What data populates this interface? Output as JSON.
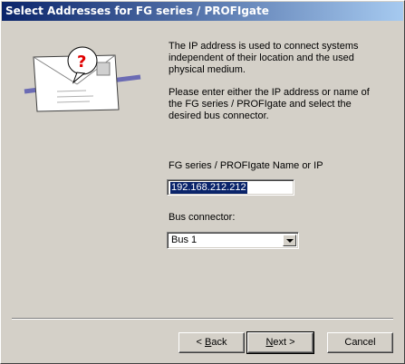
{
  "window": {
    "title": "Select Addresses for FG series / PROFIgate"
  },
  "description": [
    "The IP address is used to connect systems independent of their location and the used physical medium.",
    "Please enter either the IP address or name of the FG series / PROFIgate  and select the desired bus connector."
  ],
  "ip_field": {
    "label": "FG series / PROFIgate Name or IP",
    "value": "192.168.212.212"
  },
  "bus_field": {
    "label": "Bus connector:",
    "value": "Bus 1"
  },
  "buttons": {
    "back": {
      "prefix": "< ",
      "mnemonic": "B",
      "rest": "ack"
    },
    "next": {
      "mnemonic": "N",
      "rest": "ext >"
    },
    "cancel": "Cancel"
  },
  "colors": {
    "titlebar_start": "#0a246a",
    "titlebar_end": "#a6caf0",
    "dialog_bg": "#d4d0c8"
  }
}
